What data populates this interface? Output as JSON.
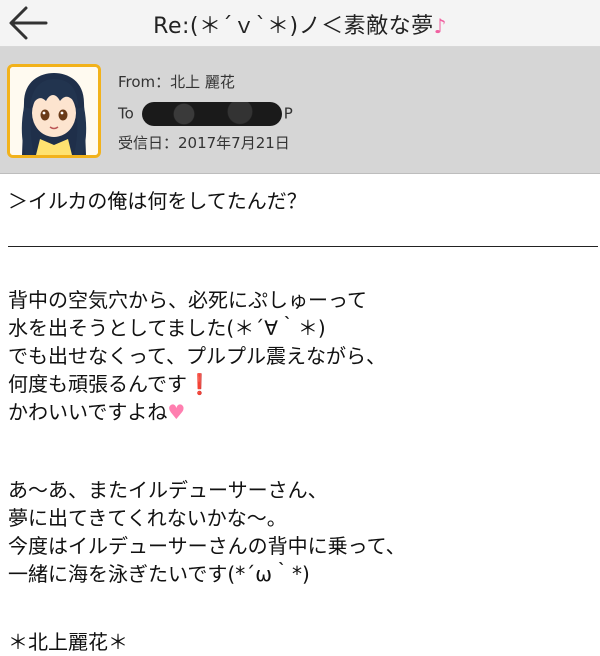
{
  "topbar": {
    "title": "Re:(＊´ｖ`＊)ノ＜素敵な夢",
    "title_note": "♪"
  },
  "header": {
    "from": "From：北上 麗花",
    "to_prefix": "To",
    "to_suffix": "P",
    "date": "受信日：2017年7月21日"
  },
  "message": {
    "quote": "＞イルカの俺は何をしてたんだ？",
    "paragraph1": [
      {
        "text": "背中の空気穴から、必死にぷしゅーって",
        "emoji": ""
      },
      {
        "text": "水を出そうとしてました(＊´∀｀＊)",
        "emoji": ""
      },
      {
        "text": "でも出せなくって、プルプル震えながら、",
        "emoji": ""
      },
      {
        "text": "何度も頑張るんです",
        "emoji": "❗"
      },
      {
        "text": "かわいいですよね",
        "emoji": "♥"
      }
    ],
    "paragraph2": [
      "あ～あ、またイルデューサーさん、",
      "夢に出てきてくれないかな～。",
      "今度はイルデューサーさんの背中に乗って、",
      "一緒に海を泳ぎたいです(*´ω｀*)"
    ],
    "signature": "＊北上麗花＊"
  }
}
